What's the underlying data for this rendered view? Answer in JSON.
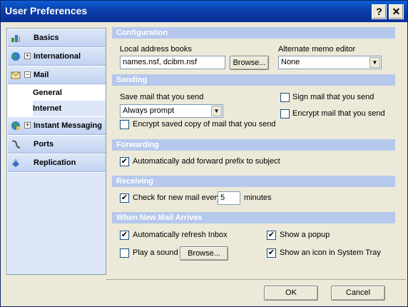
{
  "window": {
    "title": "User Preferences",
    "help_glyph": "?",
    "close_glyph": "✕"
  },
  "sidebar": {
    "items": [
      {
        "label": "Basics",
        "icon": "basics-icon",
        "expander": ""
      },
      {
        "label": "International",
        "icon": "globe-icon",
        "expander": "+"
      },
      {
        "label": "Mail",
        "icon": "mail-icon",
        "expander": "−"
      },
      {
        "label": "General"
      },
      {
        "label": "Internet"
      },
      {
        "label": "Instant Messaging",
        "icon": "im-icon",
        "expander": "+"
      },
      {
        "label": "Ports",
        "icon": "ports-icon",
        "expander": ""
      },
      {
        "label": "Replication",
        "icon": "replication-icon",
        "expander": ""
      }
    ]
  },
  "configuration": {
    "header": "Configuration",
    "address_books_label": "Local address books",
    "address_books_value": "names.nsf, dcibm.nsf",
    "browse_label": "Browse...",
    "memo_editor_label": "Alternate memo editor",
    "memo_editor_value": "None"
  },
  "sending": {
    "header": "Sending",
    "save_label": "Save mail that you send",
    "save_value": "Always prompt",
    "encrypt_saved_label": "Encrypt saved copy of mail that you send",
    "sign_label": "Sign mail that you send",
    "encrypt_label": "Encrypt mail that you send"
  },
  "forwarding": {
    "header": "Forwarding",
    "prefix_label": "Automatically add forward prefix to subject"
  },
  "receiving": {
    "header": "Receiving",
    "check_label": "Check for new mail every",
    "check_value": "5",
    "minutes_label": "minutes"
  },
  "arrival": {
    "header": "When New Mail Arrives",
    "refresh_label": "Automatically refresh Inbox",
    "sound_label": "Play a sound",
    "browse_label": "Browse...",
    "popup_label": "Show a popup",
    "tray_label": "Show an icon in System Tray"
  },
  "checkboxes": {
    "encrypt_saved": "",
    "sign": "",
    "encrypt": "",
    "prefix": "✔",
    "check_mail": "✔",
    "refresh": "✔",
    "sound": "",
    "popup": "✔",
    "tray": "✔"
  },
  "footer": {
    "ok_label": "OK",
    "cancel_label": "Cancel"
  },
  "colors": {
    "title_bar": "#0a46b8",
    "section_header": "#b6c8ec",
    "nav_bg": "#c2d3f2"
  }
}
